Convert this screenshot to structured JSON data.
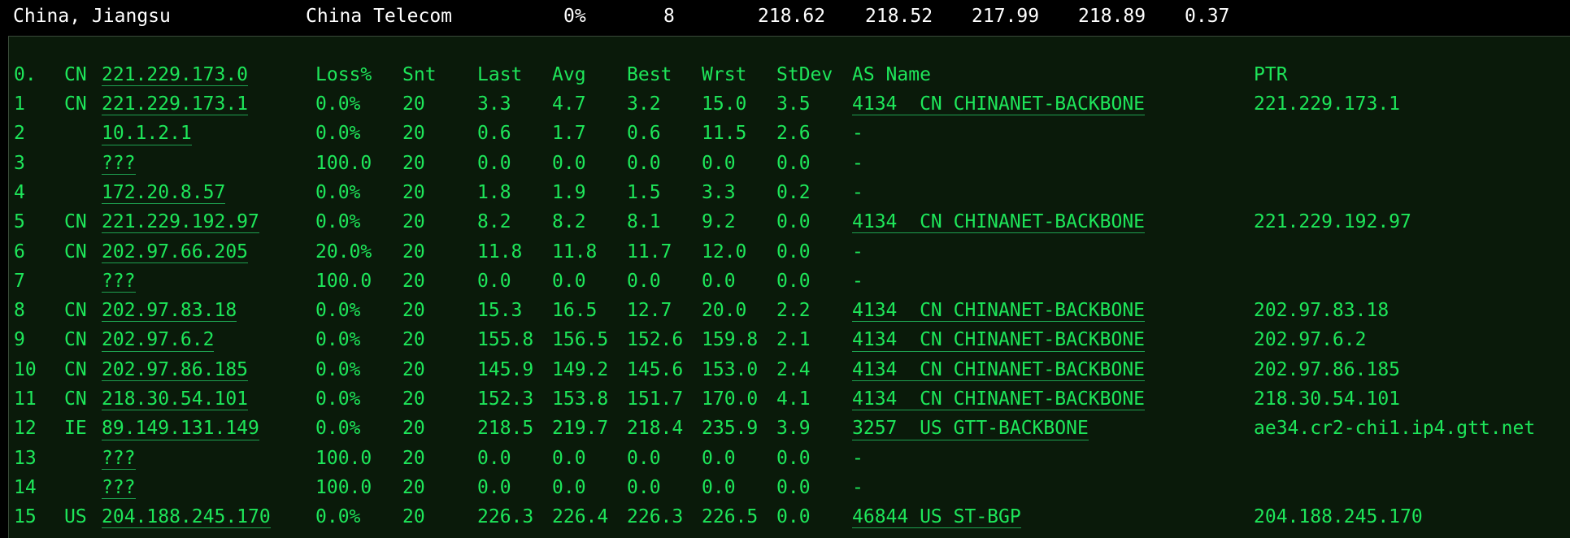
{
  "summary": {
    "location": "China, Jiangsu",
    "isp": "China Telecom",
    "loss": "0%",
    "sent": "8",
    "last": "218.62",
    "avg": "218.52",
    "best": "217.99",
    "worst": "218.89",
    "stdev": "0.37"
  },
  "trace": {
    "header": {
      "hop": "0.",
      "country": "CN",
      "host": "221.229.173.0",
      "loss": "Loss%",
      "snt": "Snt",
      "last": "Last",
      "avg": "Avg",
      "best": "Best",
      "wrst": "Wrst",
      "stdev": "StDev",
      "asname": "AS Name",
      "ptr": "PTR"
    },
    "hops": [
      {
        "hop": "1",
        "cc": "CN",
        "host": "221.229.173.1",
        "loss": "0.0%",
        "snt": "20",
        "last": "3.3",
        "avg": "4.7",
        "best": "3.2",
        "wrst": "15.0",
        "stdev": "3.5",
        "asname": "4134  CN CHINANET-BACKBONE",
        "ptr": "221.229.173.1"
      },
      {
        "hop": "2",
        "cc": "",
        "host": "10.1.2.1",
        "loss": "0.0%",
        "snt": "20",
        "last": "0.6",
        "avg": "1.7",
        "best": "0.6",
        "wrst": "11.5",
        "stdev": "2.6",
        "asname": "-",
        "ptr": ""
      },
      {
        "hop": "3",
        "cc": "",
        "host": "???",
        "loss": "100.0",
        "snt": "20",
        "last": "0.0",
        "avg": "0.0",
        "best": "0.0",
        "wrst": "0.0",
        "stdev": "0.0",
        "asname": "-",
        "ptr": ""
      },
      {
        "hop": "4",
        "cc": "",
        "host": "172.20.8.57",
        "loss": "0.0%",
        "snt": "20",
        "last": "1.8",
        "avg": "1.9",
        "best": "1.5",
        "wrst": "3.3",
        "stdev": "0.2",
        "asname": "-",
        "ptr": ""
      },
      {
        "hop": "5",
        "cc": "CN",
        "host": "221.229.192.97",
        "loss": "0.0%",
        "snt": "20",
        "last": "8.2",
        "avg": "8.2",
        "best": "8.1",
        "wrst": "9.2",
        "stdev": "0.0",
        "asname": "4134  CN CHINANET-BACKBONE",
        "ptr": "221.229.192.97"
      },
      {
        "hop": "6",
        "cc": "CN",
        "host": "202.97.66.205",
        "loss": "20.0%",
        "snt": "20",
        "last": "11.8",
        "avg": "11.8",
        "best": "11.7",
        "wrst": "12.0",
        "stdev": "0.0",
        "asname": "-",
        "ptr": ""
      },
      {
        "hop": "7",
        "cc": "",
        "host": "???",
        "loss": "100.0",
        "snt": "20",
        "last": "0.0",
        "avg": "0.0",
        "best": "0.0",
        "wrst": "0.0",
        "stdev": "0.0",
        "asname": "-",
        "ptr": ""
      },
      {
        "hop": "8",
        "cc": "CN",
        "host": "202.97.83.18",
        "loss": "0.0%",
        "snt": "20",
        "last": "15.3",
        "avg": "16.5",
        "best": "12.7",
        "wrst": "20.0",
        "stdev": "2.2",
        "asname": "4134  CN CHINANET-BACKBONE",
        "ptr": "202.97.83.18"
      },
      {
        "hop": "9",
        "cc": "CN",
        "host": "202.97.6.2",
        "loss": "0.0%",
        "snt": "20",
        "last": "155.8",
        "avg": "156.5",
        "best": "152.6",
        "wrst": "159.8",
        "stdev": "2.1",
        "asname": "4134  CN CHINANET-BACKBONE",
        "ptr": "202.97.6.2"
      },
      {
        "hop": "10",
        "cc": "CN",
        "host": "202.97.86.185",
        "loss": "0.0%",
        "snt": "20",
        "last": "145.9",
        "avg": "149.2",
        "best": "145.6",
        "wrst": "153.0",
        "stdev": "2.4",
        "asname": "4134  CN CHINANET-BACKBONE",
        "ptr": "202.97.86.185"
      },
      {
        "hop": "11",
        "cc": "CN",
        "host": "218.30.54.101",
        "loss": "0.0%",
        "snt": "20",
        "last": "152.3",
        "avg": "153.8",
        "best": "151.7",
        "wrst": "170.0",
        "stdev": "4.1",
        "asname": "4134  CN CHINANET-BACKBONE",
        "ptr": "218.30.54.101"
      },
      {
        "hop": "12",
        "cc": "IE",
        "host": "89.149.131.149",
        "loss": "0.0%",
        "snt": "20",
        "last": "218.5",
        "avg": "219.7",
        "best": "218.4",
        "wrst": "235.9",
        "stdev": "3.9",
        "asname": "3257  US GTT-BACKBONE",
        "ptr": "ae34.cr2-chi1.ip4.gtt.net"
      },
      {
        "hop": "13",
        "cc": "",
        "host": "???",
        "loss": "100.0",
        "snt": "20",
        "last": "0.0",
        "avg": "0.0",
        "best": "0.0",
        "wrst": "0.0",
        "stdev": "0.0",
        "asname": "-",
        "ptr": ""
      },
      {
        "hop": "14",
        "cc": "",
        "host": "???",
        "loss": "100.0",
        "snt": "20",
        "last": "0.0",
        "avg": "0.0",
        "best": "0.0",
        "wrst": "0.0",
        "stdev": "0.0",
        "asname": "-",
        "ptr": ""
      },
      {
        "hop": "15",
        "cc": "US",
        "host": "204.188.245.170",
        "loss": "0.0%",
        "snt": "20",
        "last": "226.3",
        "avg": "226.4",
        "best": "226.3",
        "wrst": "226.5",
        "stdev": "0.0",
        "asname": "46844 US ST-BGP",
        "ptr": "204.188.245.170"
      }
    ]
  }
}
